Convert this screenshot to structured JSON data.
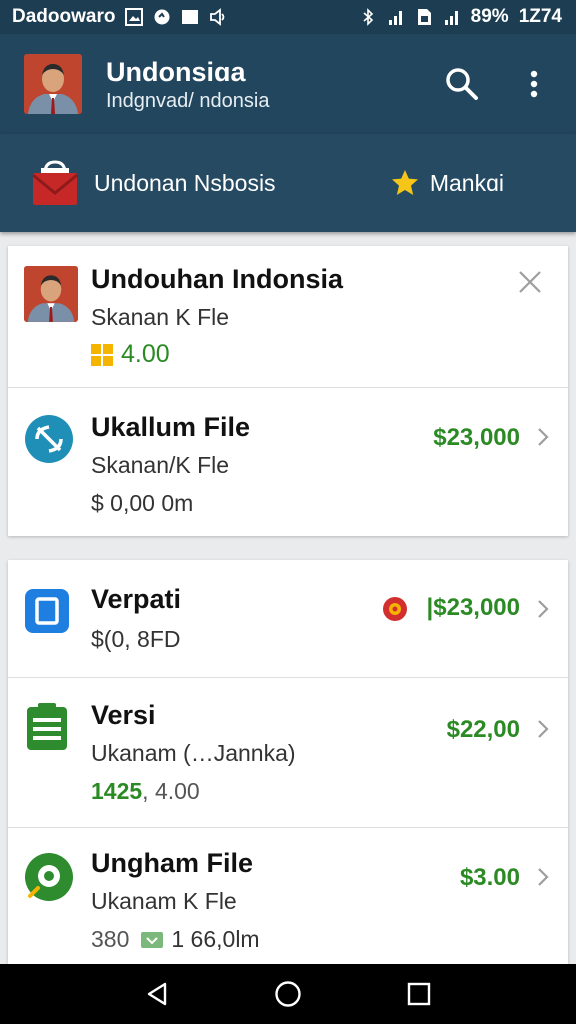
{
  "status_bar": {
    "carrier": "Dadoowaro",
    "battery": "89%",
    "time": "1Z74"
  },
  "app_bar": {
    "title": "Undonsiɑa",
    "subtitle": "Indgnvad/ ndonsia",
    "icons": [
      "avatar",
      "search-icon",
      "more-vert-icon"
    ]
  },
  "tabs": {
    "primary_label": "Undonan Nsbosis",
    "star_label": "Mankɑi"
  },
  "card1": {
    "item1": {
      "title": "Undouhan Indonsia",
      "subtitle": "Skanan K Fle",
      "rating": "4.00",
      "close_icon": "close-icon"
    },
    "item2": {
      "title": "Ukallum File",
      "subtitle": "Skanan/K Fle",
      "detail": "$ 0,00 0m",
      "price": "$23,000"
    }
  },
  "card2": {
    "item1": {
      "title": "Verpati",
      "subtitle": "$(0, 8FD",
      "price": "|$23,000"
    },
    "item2": {
      "title": "Versi",
      "subtitle": "Ukanam (…Jannka)",
      "detail_green": "1425",
      "detail_grey": ", 4.00",
      "price": "$22,00"
    },
    "item3": {
      "title": "Ungham File",
      "subtitle": "Ukanam K Fle",
      "detail_a": "380",
      "detail_b": "1 66,0lm",
      "price": "$3.00"
    }
  },
  "colors": {
    "status_bar": "#1d3e52",
    "app_bar": "#22465d",
    "tab_bar": "#254a62",
    "price_green": "#2b8a24",
    "background": "#e9ebed"
  }
}
